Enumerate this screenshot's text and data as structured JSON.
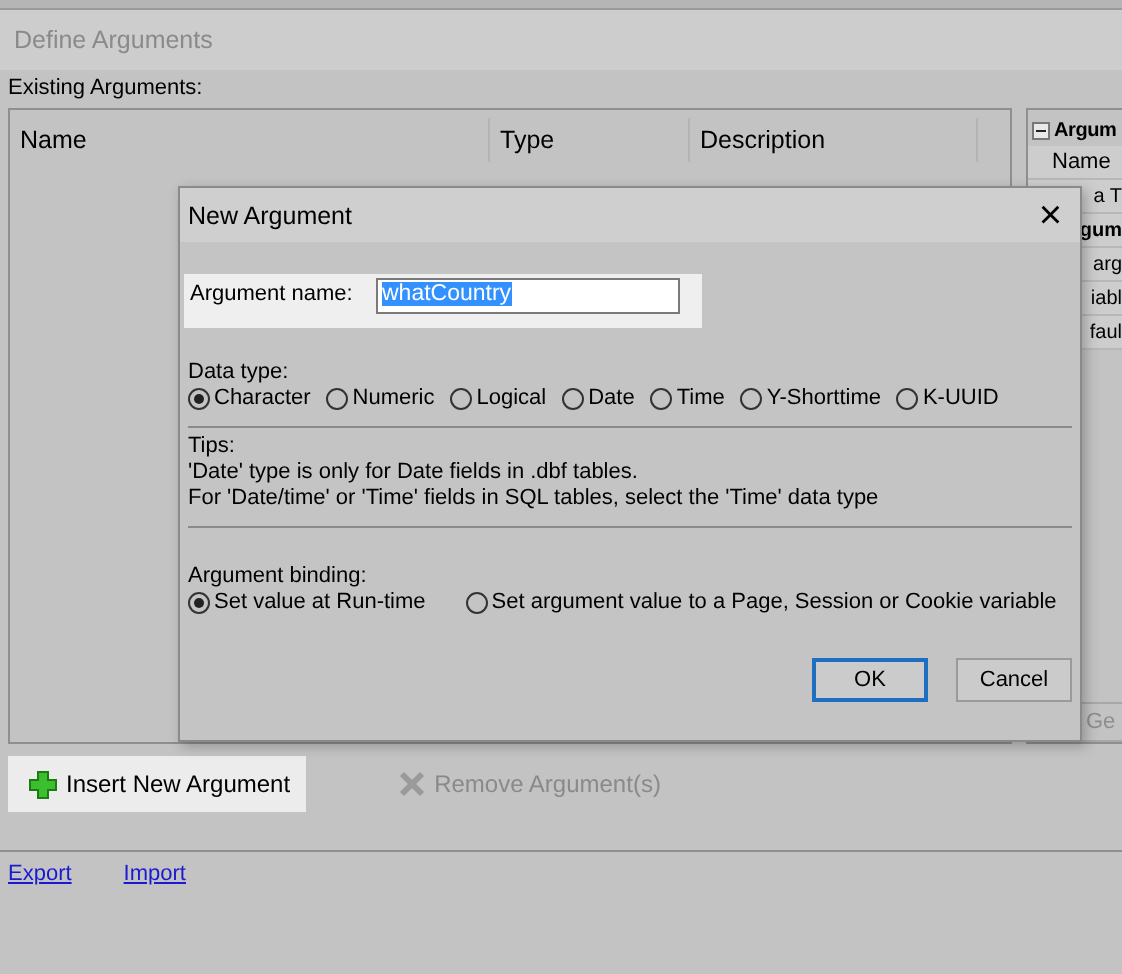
{
  "window": {
    "title": "Define Arguments"
  },
  "existing_label": "Existing Arguments:",
  "table": {
    "columns": [
      "Name",
      "Type",
      "Description"
    ]
  },
  "properties_panel": {
    "rows": [
      {
        "kind": "category",
        "text": "Argum",
        "expanded": true
      },
      {
        "kind": "row",
        "text": "Name"
      },
      {
        "kind": "clipped",
        "text": "a T"
      },
      {
        "kind": "clipped-bold",
        "text": "gum"
      },
      {
        "kind": "clipped",
        "text": "arg"
      },
      {
        "kind": "clipped",
        "text": "iabl"
      },
      {
        "kind": "clipped",
        "text": "faul"
      }
    ],
    "button": "Ge"
  },
  "toolbar": [
    {
      "kind": "insert",
      "label": "Insert New Argument",
      "disabled": false,
      "highlighted": true
    },
    {
      "kind": "remove",
      "label": "Remove Argument(s)",
      "disabled": true,
      "highlighted": false
    }
  ],
  "links": [
    "Export",
    "Import"
  ],
  "dialog": {
    "title": "New Argument",
    "close": "×",
    "name_label": "Argument name:",
    "name_value": "whatCountry",
    "name_selected": true,
    "data_type_label": "Data type:",
    "data_types": [
      {
        "label": "Character",
        "selected": true
      },
      {
        "label": "Numeric",
        "selected": false
      },
      {
        "label": "Logical",
        "selected": false
      },
      {
        "label": "Date",
        "selected": false
      },
      {
        "label": "Time",
        "selected": false
      },
      {
        "label": "Y-Shorttime",
        "selected": false
      },
      {
        "label": "K-UUID",
        "selected": false
      }
    ],
    "tips_label": "Tips:",
    "tips": [
      "'Date' type is only for Date fields in .dbf tables.",
      "For 'Date/time' or 'Time' fields in SQL tables, select the 'Time' data type"
    ],
    "binding_label": "Argument binding:",
    "bindings": [
      {
        "label": "Set value at Run-time",
        "selected": true
      },
      {
        "label": "Set argument value to a Page, Session or Cookie variable",
        "selected": false
      }
    ],
    "buttons": [
      {
        "label": "OK",
        "default": true
      },
      {
        "label": "Cancel",
        "default": false
      }
    ]
  }
}
